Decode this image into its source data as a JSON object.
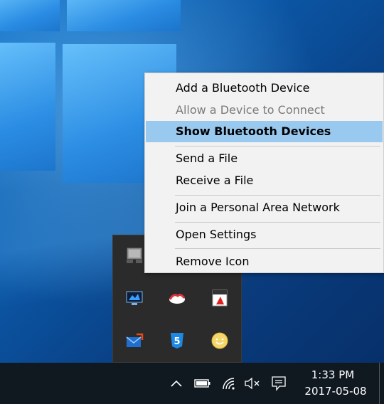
{
  "context_menu": {
    "items": [
      {
        "label": "Add a Bluetooth Device",
        "state": "normal"
      },
      {
        "label": "Allow a Device to Connect",
        "state": "disabled"
      },
      {
        "label": "Show Bluetooth Devices",
        "state": "highlighted"
      },
      {
        "label": "Send a File",
        "state": "normal"
      },
      {
        "label": "Receive a File",
        "state": "normal"
      },
      {
        "label": "Join a Personal Area Network",
        "state": "normal"
      },
      {
        "label": "Open Settings",
        "state": "normal"
      },
      {
        "label": "Remove Icon",
        "state": "normal"
      }
    ],
    "highlight_color": "#99c9ef"
  },
  "tray_flyout": {
    "icons": [
      "network-drive-icon",
      "monitor-app-icon",
      "cloud-sync-icon",
      "dsm-icon",
      "email-arrow-icon",
      "html5-shield-icon",
      "smiley-icon"
    ]
  },
  "taskbar": {
    "clock": {
      "time": "1:33 PM",
      "date": "2017-05-08"
    },
    "icons": [
      "chevron-up-icon",
      "battery-icon",
      "wifi-icon",
      "speaker-muted-icon",
      "action-center-icon"
    ],
    "background": "#101820"
  }
}
